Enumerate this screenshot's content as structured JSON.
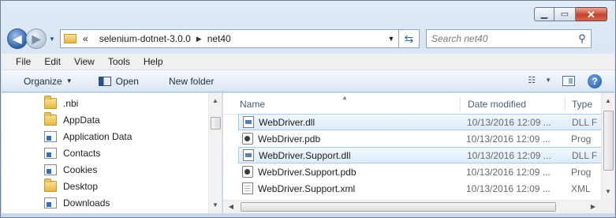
{
  "address": {
    "overflow": "«",
    "crumbs": [
      "selenium-dotnet-3.0.0",
      "net40"
    ]
  },
  "search": {
    "placeholder": "Search net40"
  },
  "menu": [
    "File",
    "Edit",
    "View",
    "Tools",
    "Help"
  ],
  "toolbar": {
    "organize": "Organize",
    "open": "Open",
    "new_folder": "New folder"
  },
  "tree": [
    {
      "label": ".nbi",
      "icon": "folder-icon"
    },
    {
      "label": "AppData",
      "icon": "folder-icon"
    },
    {
      "label": "Application Data",
      "icon": "shortcut-folder-icon"
    },
    {
      "label": "Contacts",
      "icon": "shortcut-folder-icon"
    },
    {
      "label": "Cookies",
      "icon": "shortcut-folder-icon"
    },
    {
      "label": "Desktop",
      "icon": "folder-icon"
    },
    {
      "label": "Downloads",
      "icon": "shortcut-folder-icon"
    }
  ],
  "columns": {
    "name": "Name",
    "date": "Date modified",
    "type": "Type"
  },
  "files": [
    {
      "name": "WebDriver.dll",
      "date": "10/13/2016 12:09 ...",
      "type": "DLL F",
      "kind": "dll",
      "selected": true
    },
    {
      "name": "WebDriver.pdb",
      "date": "10/13/2016 12:09 ...",
      "type": "Prog",
      "kind": "pdb",
      "selected": false
    },
    {
      "name": "WebDriver.Support.dll",
      "date": "10/13/2016 12:09 ...",
      "type": "DLL F",
      "kind": "dll",
      "selected": true
    },
    {
      "name": "WebDriver.Support.pdb",
      "date": "10/13/2016 12:09 ...",
      "type": "Prog",
      "kind": "pdb",
      "selected": false
    },
    {
      "name": "WebDriver.Support.xml",
      "date": "10/13/2016 12:09 ...",
      "type": "XML",
      "kind": "xml",
      "selected": false
    }
  ],
  "colors": {
    "selection_fill": "#dcebfc",
    "selection_border": "#a8cbee",
    "close_red": "#c8432b"
  }
}
